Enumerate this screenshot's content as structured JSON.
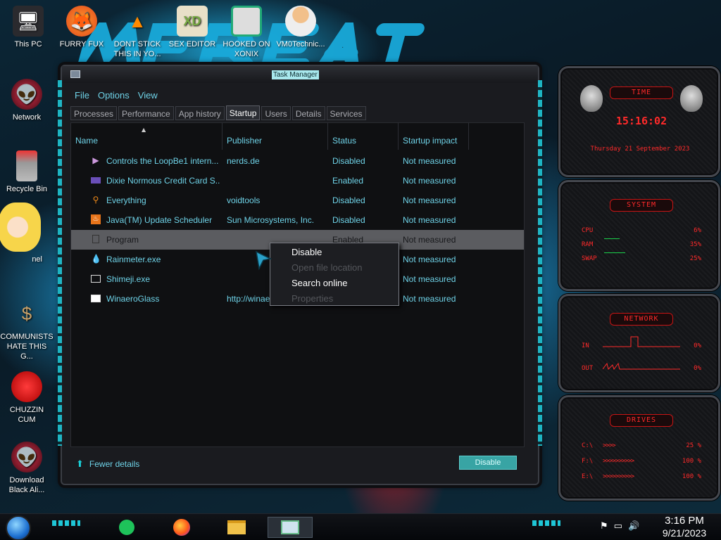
{
  "desktop": {
    "icons": [
      {
        "label": "This PC",
        "icon": "computer-icon"
      },
      {
        "label": "FURRY FUX",
        "icon": "firefox-icon"
      },
      {
        "label": "DONT STICK THIS IN YO...",
        "icon": "vlc-icon"
      },
      {
        "label": "SEX EDITOR",
        "icon": "xd-icon"
      },
      {
        "label": "HOOKED ON XONIX",
        "icon": "xonix-icon"
      },
      {
        "label": "VM0Technic...",
        "icon": "doctor-icon"
      },
      {
        "label": "Network",
        "icon": "alien-network-icon"
      },
      {
        "label": "Recycle Bin",
        "icon": "recycle-bin-icon"
      },
      {
        "label": "nel",
        "icon": "star-butterfly-icon"
      },
      {
        "label": "COMMUNISTS HATE THIS G...",
        "icon": "money-bag-icon"
      },
      {
        "label": "CHUZZIN CUM",
        "icon": "chuzzle-icon"
      },
      {
        "label": "Download Black Ali...",
        "icon": "alien-download-icon"
      }
    ]
  },
  "task_manager": {
    "title": "Task Manager",
    "menu": [
      "File",
      "Options",
      "View"
    ],
    "tabs": [
      "Processes",
      "Performance",
      "App history",
      "Startup",
      "Users",
      "Details",
      "Services"
    ],
    "active_tab": "Startup",
    "columns": {
      "name": "Name",
      "publisher": "Publisher",
      "status": "Status",
      "impact": "Startup impact"
    },
    "rows": [
      {
        "name": "Controls the LoopBe1 intern...",
        "publisher": "nerds.de",
        "status": "Disabled",
        "impact": "Not measured",
        "icon": "loopbe-icon"
      },
      {
        "name": "Dixie Normous Credit Card S...",
        "publisher": "",
        "status": "Enabled",
        "impact": "Not measured",
        "icon": "credit-card-icon"
      },
      {
        "name": "Everything",
        "publisher": "voidtools",
        "status": "Disabled",
        "impact": "Not measured",
        "icon": "magnifier-icon"
      },
      {
        "name": "Java(TM) Update Scheduler",
        "publisher": "Sun Microsystems, Inc.",
        "status": "Disabled",
        "impact": "Not measured",
        "icon": "java-icon"
      },
      {
        "name": "Program",
        "publisher": "",
        "status": "Enabled",
        "impact": "Not measured",
        "icon": "program-icon"
      },
      {
        "name": "Rainmeter.exe",
        "publisher": "",
        "status": "",
        "impact": "Not measured",
        "icon": "rainmeter-icon"
      },
      {
        "name": "Shimeji.exe",
        "publisher": "",
        "status": "",
        "impact": "Not measured",
        "icon": "shimeji-icon"
      },
      {
        "name": "WinaeroGlass",
        "publisher": "http://winae",
        "status": "",
        "impact": "Not measured",
        "icon": "winaero-icon"
      }
    ],
    "selected_row": "Program",
    "footer": {
      "fewer_details": "Fewer details",
      "disable_button": "Disable"
    }
  },
  "context_menu": {
    "items": [
      {
        "label": "Disable",
        "enabled": true
      },
      {
        "label": "Open file location",
        "enabled": false
      },
      {
        "label": "Search online",
        "enabled": true
      },
      {
        "label": "Properties",
        "enabled": false
      }
    ]
  },
  "gadgets": {
    "time": {
      "title": "TIME",
      "clock": "15:16:02",
      "date": "Thursday 21 September 2023"
    },
    "system": {
      "title": "SYSTEM",
      "cpu_label": "CPU",
      "cpu": "6%",
      "ram_label": "RAM",
      "ram": "35%",
      "swap_label": "SWAP",
      "swap": "25%"
    },
    "network": {
      "title": "NETWORK",
      "in_label": "IN",
      "in": "0%",
      "out_label": "OUT",
      "out": "0%"
    },
    "drives": {
      "title": "DRIVES",
      "c_label": "C:\\",
      "c": "25 %",
      "f_label": "F:\\",
      "f": "100 %",
      "e_label": "E:\\",
      "e": "100 %"
    }
  },
  "taskbar": {
    "apps": [
      "notes-icon",
      "firefox-icon",
      "file-explorer-icon",
      "task-manager-icon"
    ],
    "active_app": "task-manager-icon",
    "tray": [
      "flag-icon",
      "network-icon",
      "volume-icon"
    ],
    "time": "3:16 PM",
    "date": "9/21/2023"
  },
  "colors": {
    "accent": "#6fd3e8",
    "gadget_red": "#ff2a2a",
    "selection": "#5b5c60",
    "button": "#38a4a4"
  }
}
